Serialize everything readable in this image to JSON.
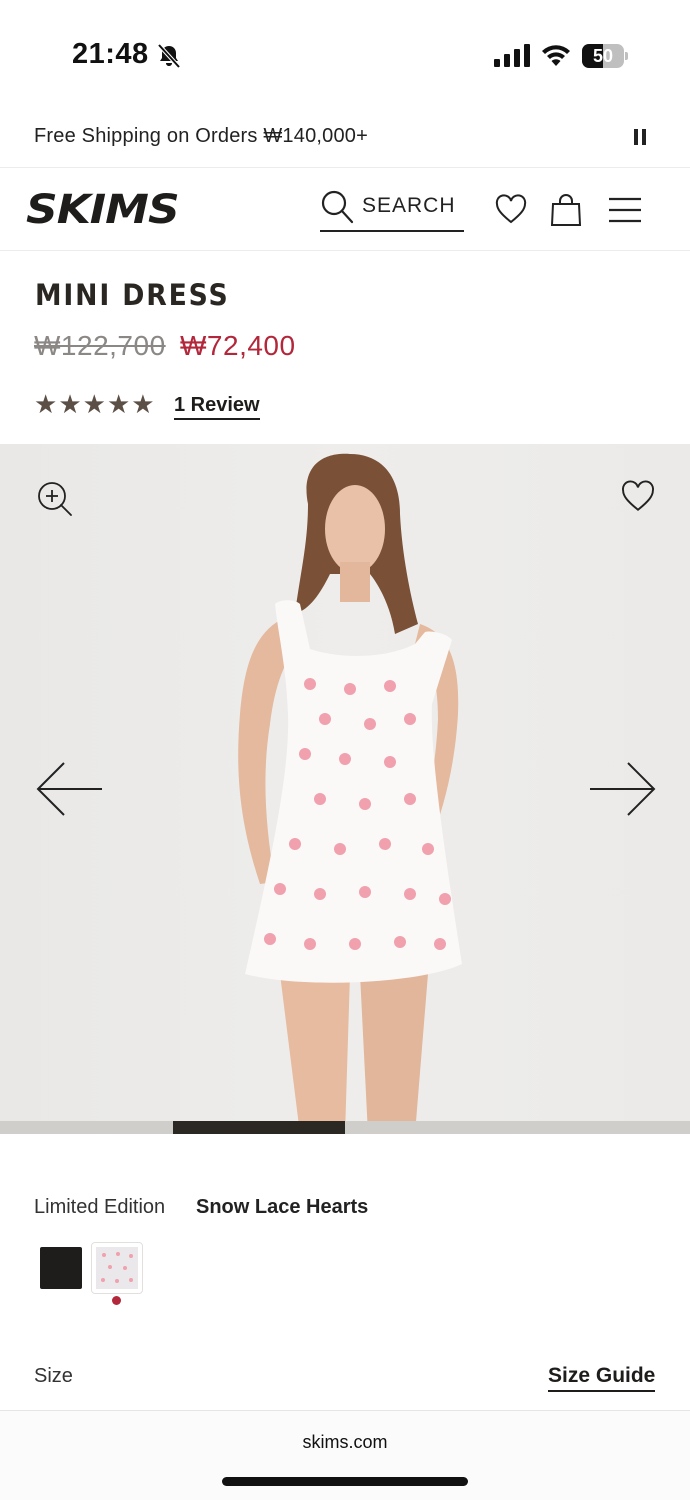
{
  "status_bar": {
    "time": "21:48",
    "battery_level": "50",
    "battery_fraction": 0.5,
    "icons": [
      "bell-off-icon",
      "cellular-signal-icon",
      "wifi-icon",
      "battery-icon"
    ]
  },
  "promo": {
    "text": "Free Shipping on Orders ₩140,000+",
    "pause_icon": "pause-icon"
  },
  "header": {
    "logo": "SKIMS",
    "search_label": "SEARCH",
    "icons": [
      "search-icon",
      "heart-icon",
      "bag-icon",
      "menu-icon"
    ]
  },
  "product": {
    "title": "MINI DRESS",
    "price_original": "₩122,700",
    "price_sale": "₩72,400",
    "rating_stars": 5,
    "star_glyphs": [
      "★",
      "★",
      "★",
      "★",
      "★"
    ],
    "review_link": "1 Review"
  },
  "gallery": {
    "icons": [
      "zoom-in-icon",
      "heart-outline-icon",
      "arrow-left-icon",
      "arrow-right-icon"
    ],
    "progress": {
      "segments": 4,
      "active_segment": 2
    }
  },
  "color": {
    "label": "Limited Edition",
    "selected": "Snow Lace Hearts",
    "swatches": [
      "Black",
      "Snow Lace Hearts"
    ],
    "swatch_colors": [
      "#1f1d1b",
      "#ebe8ec"
    ],
    "selected_indicator_color": "#b3273b"
  },
  "size": {
    "label": "Size",
    "guide_link": "Size Guide"
  },
  "browser": {
    "url": "skims.com"
  },
  "colors": {
    "sale_price": "#b3273b",
    "text": "#1f1d1b",
    "star": "#5c5046"
  }
}
